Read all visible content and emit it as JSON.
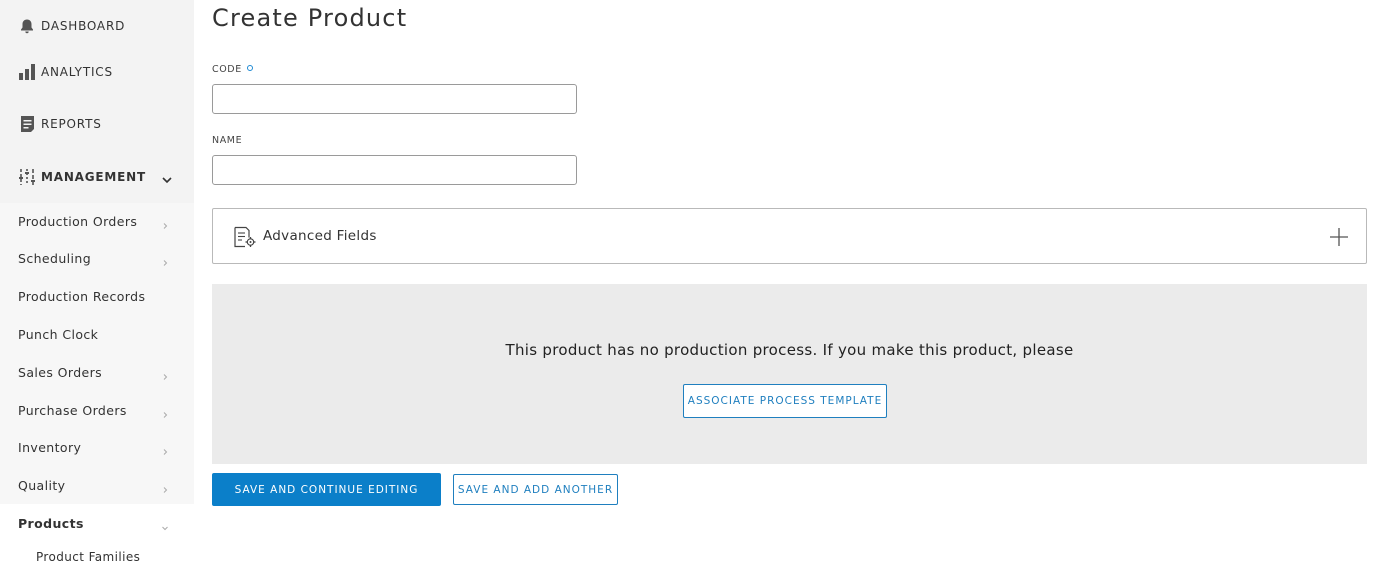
{
  "sidebar": {
    "top_items": [
      {
        "label": "DASHBOARD",
        "icon": "bell-icon"
      },
      {
        "label": "ANALYTICS",
        "icon": "bar-chart-icon"
      },
      {
        "label": "REPORTS",
        "icon": "document-icon"
      }
    ],
    "management": {
      "label": "MANAGEMENT",
      "icon": "sliders-icon"
    },
    "sub_items": [
      {
        "label": "Production Orders",
        "has_chevron": true
      },
      {
        "label": "Scheduling",
        "has_chevron": true
      },
      {
        "label": "Production Records",
        "has_chevron": false
      },
      {
        "label": "Punch Clock",
        "has_chevron": false
      },
      {
        "label": "Sales Orders",
        "has_chevron": true
      },
      {
        "label": "Purchase Orders",
        "has_chevron": true
      },
      {
        "label": "Inventory",
        "has_chevron": true
      },
      {
        "label": "Quality",
        "has_chevron": true
      },
      {
        "label": "Products",
        "has_chevron": true,
        "expanded": true
      }
    ],
    "products_children": [
      {
        "label": "Product Families"
      }
    ]
  },
  "main": {
    "title": "Create Product",
    "fields": {
      "code": {
        "label": "CODE",
        "value": "",
        "required": true
      },
      "name": {
        "label": "NAME",
        "value": ""
      }
    },
    "advanced": {
      "label": "Advanced Fields",
      "icon": "document-gear-icon"
    },
    "process": {
      "message": "This product has no production process. If you make this product, please",
      "button": "ASSOCIATE PROCESS TEMPLATE"
    },
    "actions": {
      "save_continue": "SAVE AND CONTINUE EDITING",
      "save_another": "SAVE AND ADD ANOTHER"
    }
  },
  "colors": {
    "accent": "#0b7fc9",
    "sidebar_bg": "#f3f3f3",
    "panel_bg": "#ebebeb"
  }
}
